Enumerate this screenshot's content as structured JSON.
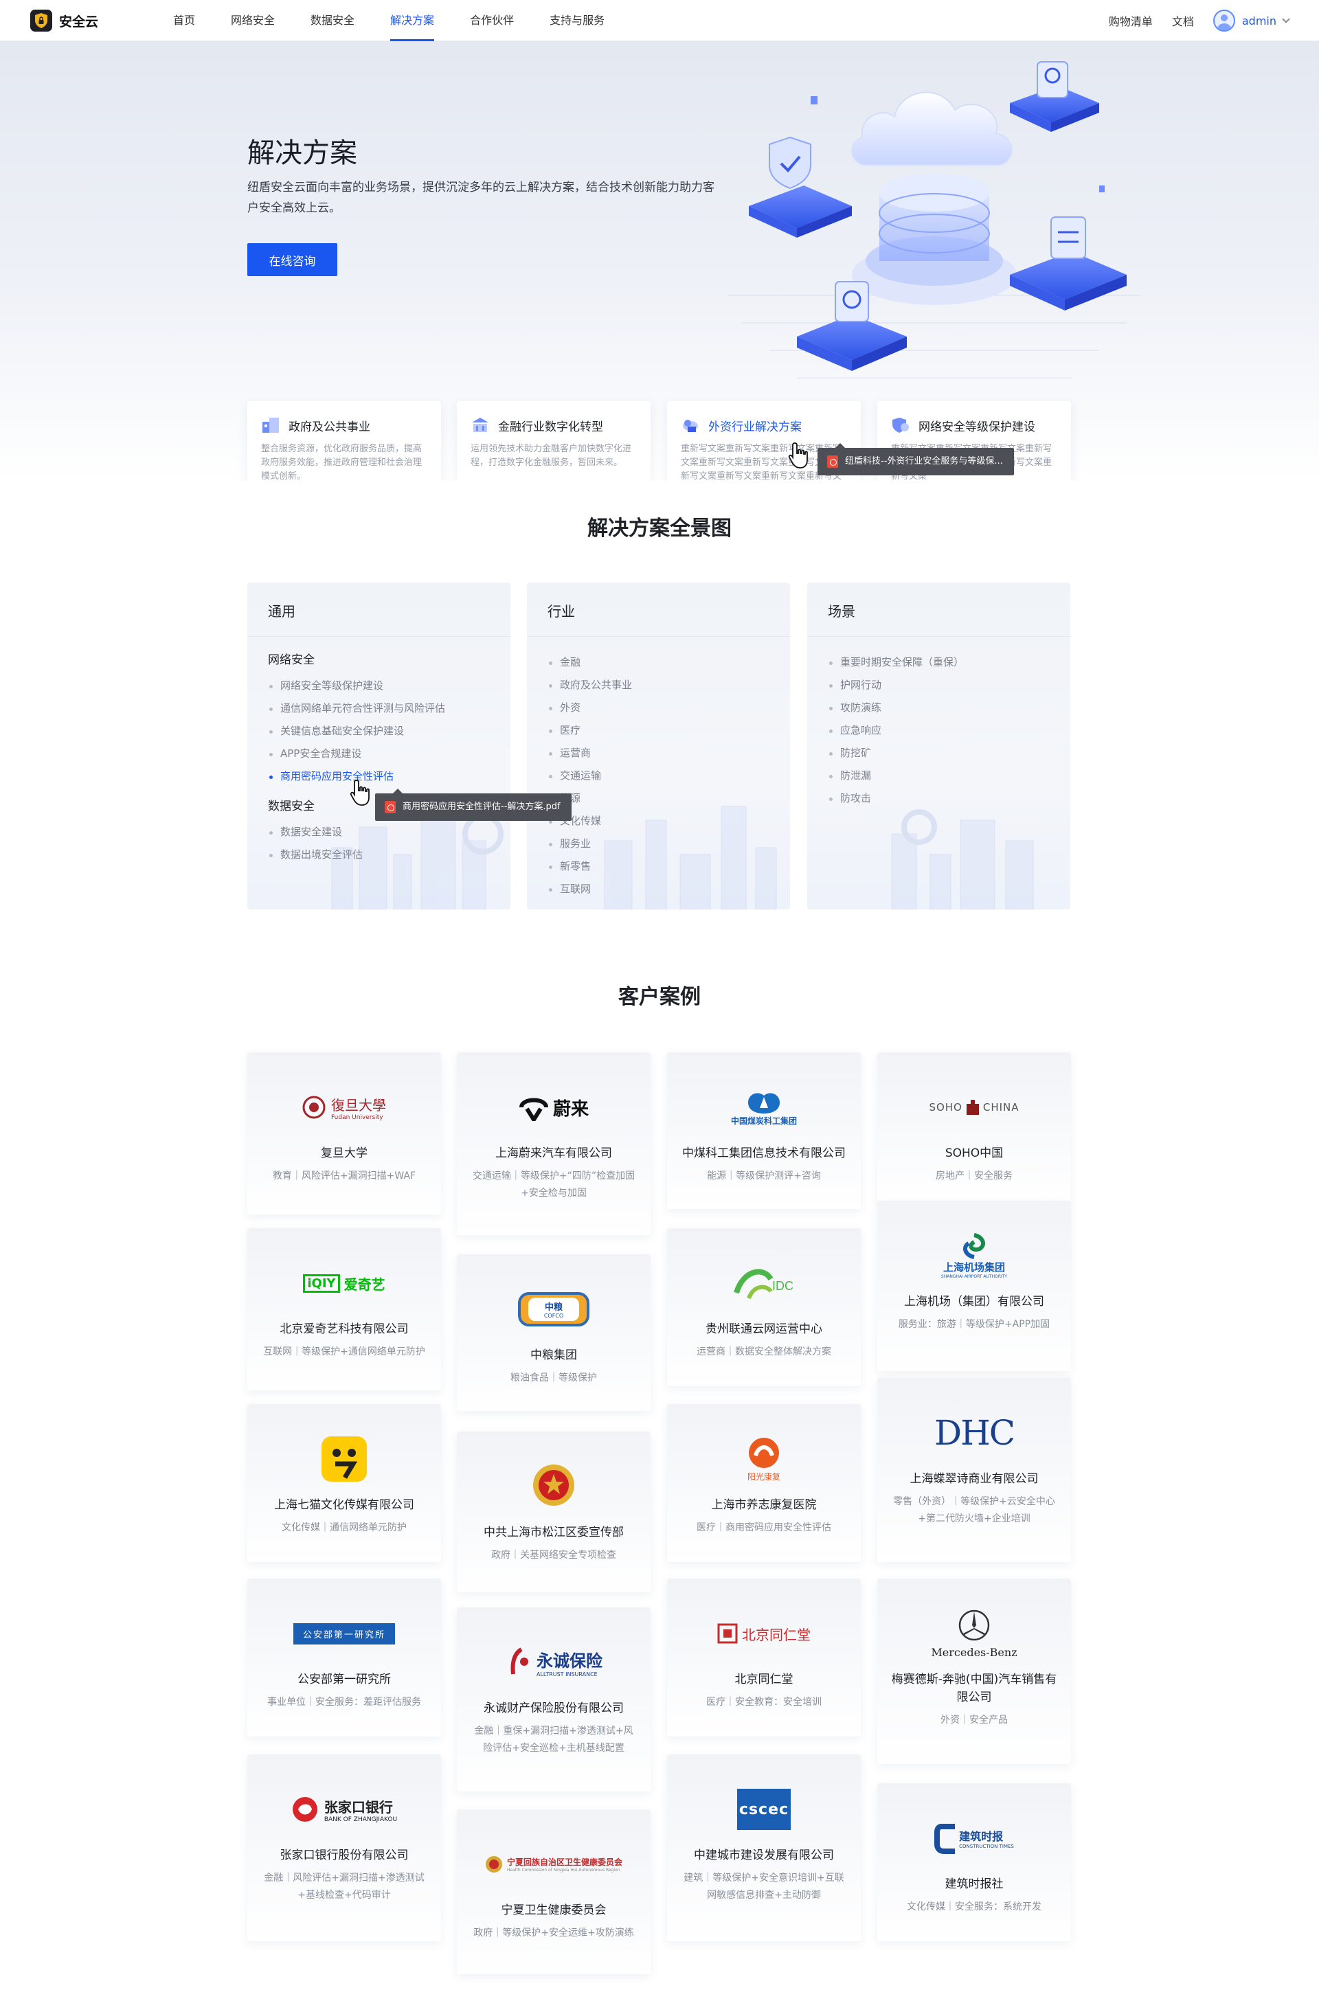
{
  "header": {
    "logo_text": "安全云",
    "nav": [
      "首页",
      "网络安全",
      "数据安全",
      "解决方案",
      "合作伙伴",
      "支持与服务"
    ],
    "active_nav": "解决方案",
    "cart": "购物清单",
    "docs": "文档",
    "user": "admin"
  },
  "hero": {
    "title": "解决方案",
    "desc": "纽盾安全云面向丰富的业务场景，提供沉淀多年的云上解决方案，结合技术创新能力助力客户安全高效上云。",
    "button": "在线咨询",
    "cards": [
      {
        "title": "政府及公共事业",
        "desc": "整合服务资源，优化政府服务品质，提高政府服务效能，推进政府管理和社会治理模式创新。"
      },
      {
        "title": "金融行业数字化转型",
        "desc": "运用领先技术助力金融客户加快数字化进程，打造数字化金融服务，暂回未来。"
      },
      {
        "title": "外资行业解决方案",
        "desc": "重新写文案重新写文案重新写文案重新写文案重新写文案重新写文案重新写文案重新写文案重新写文案重新写文案重新写文"
      },
      {
        "title": "网络安全等级保护建设",
        "desc": "重新写文案重新写文案重新写文案重新写文案重新写文案重新写文案重新写文案重新写文案"
      }
    ],
    "tooltip": "纽盾科技--外资行业安全服务与等级保..."
  },
  "panorama": {
    "title": "解决方案全景图",
    "general": {
      "title": "通用",
      "groups": [
        {
          "title": "网络安全",
          "items": [
            "网络安全等级保护建设",
            "通信网络单元符合性评测与风险评估",
            "关键信息基础安全保护建设",
            "APP安全合规建设",
            "商用密码应用安全性评估"
          ]
        },
        {
          "title": "数据安全",
          "items": [
            "数据安全建设",
            "数据出境安全评估"
          ]
        }
      ]
    },
    "industry": {
      "title": "行业",
      "items": [
        "金融",
        "政府及公共事业",
        "外资",
        "医疗",
        "运营商",
        "交通运输",
        "能源",
        "文化传媒",
        "服务业",
        "新零售",
        "互联网"
      ]
    },
    "scene": {
      "title": "场景",
      "items": [
        "重要时期安全保障（重保）",
        "护网行动",
        "攻防演练",
        "应急响应",
        "防挖矿",
        "防泄漏",
        "防攻击"
      ]
    },
    "tooltip": "商用密码应用安全性评估--解决方案.pdf"
  },
  "cases": {
    "title": "客户案例",
    "items": [
      {
        "logo": "復旦大學",
        "logo_sub": "Fudan University",
        "name": "复旦大学",
        "tags": "教育｜风险评估+漏洞扫描+WAF"
      },
      {
        "logo": "蔚来",
        "name": "上海蔚来汽车有限公司",
        "tags": "交通运输｜等级保护+“四防”检查加固+安全检与加固"
      },
      {
        "logo": "中国煤炭科工集团",
        "name": "中煤科工集团信息技术有限公司",
        "tags": "能源｜等级保护测评+咨询"
      },
      {
        "logo": "SOHO中国",
        "logo_left": "SOHO",
        "logo_right": "CHINA",
        "name": "SOHO中国",
        "tags": "房地产｜安全服务"
      },
      {
        "logo": "爱奇艺",
        "logo_mark": "iQIY",
        "name": "北京爱奇艺科技有限公司",
        "tags": "互联网｜等级保护+通信网络单元防护"
      },
      {
        "logo": "中粮",
        "logo_sub": "COFCO",
        "name": "中粮集团",
        "tags": "粮油食品｜等级保护"
      },
      {
        "logo": "贵州IDC",
        "name": "贵州联通云网运营中心",
        "tags": "运营商｜数据安全整体解决方案"
      },
      {
        "logo": "上海机场集团",
        "logo_sub": "SHANGHAI AIRPORT AUTHORITY",
        "name": "上海机场（集团）有限公司",
        "tags": "服务业：旅游｜等级保护+APP加固"
      },
      {
        "logo": "七猫",
        "name": "上海七猫文化传媒有限公司",
        "tags": "文化传媒｜通信网络单元防护"
      },
      {
        "logo": "国徽",
        "name": "中共上海市松江区委宣传部",
        "tags": "政府｜关基网络安全专项检查"
      },
      {
        "logo": "阳光康复",
        "name": "上海市养志康复医院",
        "tags": "医疗｜商用密码应用安全性评估"
      },
      {
        "logo": "DHC",
        "name": "上海蝶翠诗商业有限公司",
        "tags": "零售（外资）｜等级保护+云安全中心+第二代防火墙+企业培训"
      },
      {
        "logo": "公安部第一研究所",
        "name": "公安部第一研究所",
        "tags": "事业单位｜安全服务：差距评估服务"
      },
      {
        "logo": "永诚保险",
        "logo_sub": "ALLTRUST INSURANCE",
        "name": "永诚财产保险股份有限公司",
        "tags": "金融｜重保+漏洞扫描+渗透测试+风险评估+安全巡检+主机基线配置"
      },
      {
        "logo": "北京同仁堂",
        "name": "北京同仁堂",
        "tags": "医疗｜安全教育：安全培训"
      },
      {
        "logo": "Mercedes-Benz",
        "name": "梅赛德斯-奔驰(中国)汽车销售有限公司",
        "tags": "外资｜安全产品"
      },
      {
        "logo": "张家口银行",
        "logo_sub": "BANK OF ZHANGJIAKOU",
        "name": "张家口银行股份有限公司",
        "tags": "金融｜风险评估+漏洞扫描+渗透测试+基线检查+代码审计"
      },
      {
        "logo": "宁夏回族自治区卫生健康委员会",
        "logo_sub": "Health Commission of Ningxia Hui Autonomous Region",
        "name": "宁夏卫生健康委员会",
        "tags": "政府｜等级保护+安全运维+攻防演练"
      },
      {
        "logo": "cscec",
        "name": "中建城市建设发展有限公司",
        "tags": "建筑｜等级保护+安全意识培训+互联网敏感信息排查+主动防御"
      },
      {
        "logo": "建筑时报",
        "logo_sub": "CONSTRUCTION TIMES",
        "name": "建筑时报社",
        "tags": "文化传媒｜安全服务：系统开发"
      }
    ]
  },
  "colors": {
    "primary": "#1a56f0",
    "text": "#1f2329",
    "muted": "#8a909b"
  }
}
